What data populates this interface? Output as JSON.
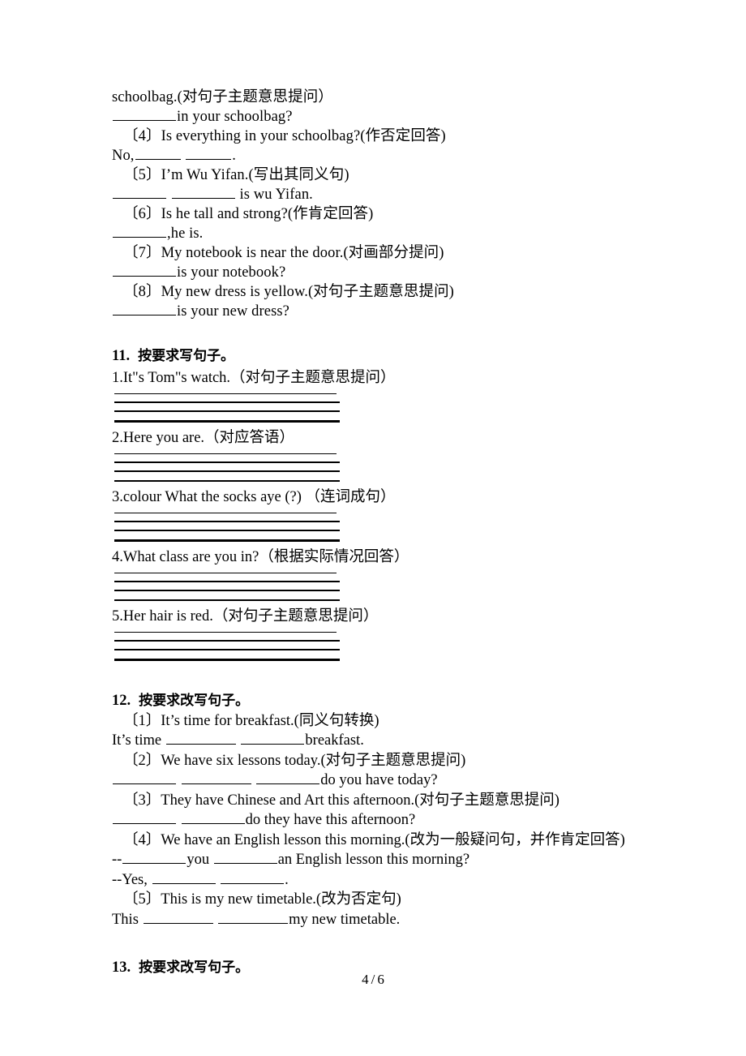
{
  "document": {
    "footer": {
      "current_page": "4",
      "separator": "/",
      "total_pages": "6"
    }
  },
  "top_section": {
    "carryover_line": "schoolbag.(对句子主题意思提问）",
    "carryover_answer_tail": "in your schoolbag?",
    "items": [
      {
        "marker": "〔4〕",
        "prompt": "Is everything in your schoolbag?(作否定回答)",
        "answer_prefix": "No,",
        "answer_suffix": "."
      },
      {
        "marker": "〔5〕",
        "prompt": "I’m Wu Yifan.(写出其同义句)",
        "answer_prefix": "",
        "answer_suffix": "is wu Yifan."
      },
      {
        "marker": "〔6〕",
        "prompt": "Is he tall and strong?(作肯定回答)",
        "answer_prefix": "",
        "answer_suffix": ",he is."
      },
      {
        "marker": "〔7〕",
        "prompt": "My notebook is near the door.(对画部分提问)",
        "answer_prefix": "",
        "answer_suffix": "is your notebook?"
      },
      {
        "marker": "〔8〕",
        "prompt": "My new dress is yellow.(对句子主题意思提问)",
        "answer_prefix": "",
        "answer_suffix": "is your new dress?"
      }
    ]
  },
  "section_11": {
    "number": "11.",
    "title": "按要求写句子。",
    "questions": [
      {
        "text": "1.It\"s Tom\"s watch.（对句子主题意思提问）"
      },
      {
        "text": "2.Here you are.（对应答语）"
      },
      {
        "text": "3.colour What the socks aye  (?) （连词成句）"
      },
      {
        "text": "4.What class are you in?（根据实际情况回答）"
      },
      {
        "text": "5.Her hair is red.（对句子主题意思提问）"
      }
    ]
  },
  "section_12": {
    "number": "12.",
    "title": "按要求改写句子。",
    "items": [
      {
        "marker": "〔1〕",
        "prompt": "It’s time for breakfast.(同义句转换)",
        "answer_prefix": "It’s time",
        "answer_suffix": "breakfast."
      },
      {
        "marker": "〔2〕",
        "prompt": "We have six lessons today.(对句子主题意思提问)",
        "answer_prefix": "",
        "answer_suffix": "do you have today?"
      },
      {
        "marker": "〔3〕",
        "prompt": "They have Chinese and Art this afternoon.(对句子主题意思提问)",
        "answer_prefix": "",
        "answer_suffix": "do they have this afternoon?"
      },
      {
        "marker": "〔4〕",
        "prompt": "We have an English lesson this morning.(改为一般疑问句，并作肯定回答)",
        "answer_prefix": "--",
        "answer_middle": "you",
        "answer_suffix": "an English lesson this morning?",
        "answer_line2_prefix": "--Yes,",
        "answer_line2_suffix": "."
      },
      {
        "marker": "〔5〕",
        "prompt": "This is my new timetable.(改为否定句)",
        "answer_prefix": "This",
        "answer_suffix": "my new timetable."
      }
    ]
  },
  "section_13": {
    "number": "13.",
    "title": "按要求改写句子。"
  }
}
